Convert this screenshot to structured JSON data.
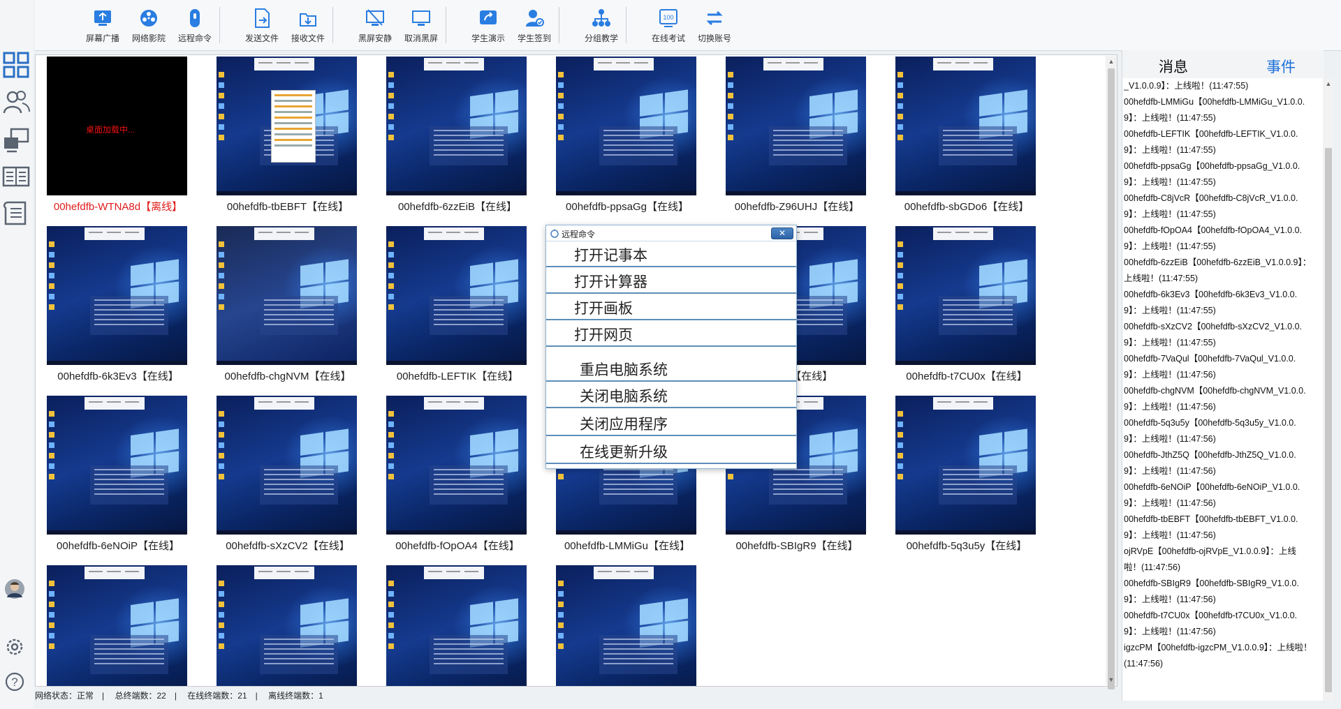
{
  "toolbar": {
    "groups": [
      [
        {
          "label": "屏幕广播",
          "icon": "screen-broadcast-icon"
        },
        {
          "label": "网络影院",
          "icon": "network-cinema-icon"
        },
        {
          "label": "远程命令",
          "icon": "remote-command-icon"
        }
      ],
      [
        {
          "label": "发送文件",
          "icon": "send-file-icon"
        },
        {
          "label": "接收文件",
          "icon": "receive-file-icon"
        }
      ],
      [
        {
          "label": "黑屏安静",
          "icon": "black-screen-icon"
        },
        {
          "label": "取消黑屏",
          "icon": "cancel-black-screen-icon"
        }
      ],
      [
        {
          "label": "学生演示",
          "icon": "student-demo-icon"
        },
        {
          "label": "学生签到",
          "icon": "student-signin-icon"
        }
      ],
      [
        {
          "label": "分组教学",
          "icon": "group-teaching-icon"
        }
      ],
      [
        {
          "label": "在线考试",
          "icon": "online-exam-icon"
        },
        {
          "label": "切换账号",
          "icon": "switch-account-icon"
        }
      ]
    ],
    "accent": "#1a6ed8"
  },
  "left_nav": {
    "items": [
      "grid-view-icon",
      "users-icon",
      "terminal-icon",
      "book-icon",
      "document-icon",
      "avatar",
      "settings-icon",
      "help-icon"
    ]
  },
  "terminals": [
    {
      "name": "00hefdfb-WTNA8d【离线】",
      "status": "offline",
      "screen_text": "桌面加载中..."
    },
    {
      "name": "00hefdfb-tbEBFT【在线】",
      "status": "online"
    },
    {
      "name": "00hefdfb-6zzEiB【在线】",
      "status": "online"
    },
    {
      "name": "00hefdfb-ppsaGg【在线】",
      "status": "online"
    },
    {
      "name": "00hefdfb-Z96UHJ【在线】",
      "status": "online"
    },
    {
      "name": "00hefdfb-sbGDo6【在线】",
      "status": "online"
    },
    {
      "name": "00hefdfb-6k3Ev3【在线】",
      "status": "online"
    },
    {
      "name": "00hefdfb-chgNVM【在线】",
      "status": "online"
    },
    {
      "name": "00hefdfb-LEFTIK【在线】",
      "status": "online"
    },
    {
      "name": "",
      "status": "hidden"
    },
    {
      "name": "mU5N【在线】",
      "status": "online"
    },
    {
      "name": "00hefdfb-t7CU0x【在线】",
      "status": "online"
    },
    {
      "name": "00hefdfb-6eNOiP【在线】",
      "status": "online"
    },
    {
      "name": "00hefdfb-sXzCV2【在线】",
      "status": "online"
    },
    {
      "name": "00hefdfb-fOpOA4【在线】",
      "status": "online"
    },
    {
      "name": "00hefdfb-LMMiGu【在线】",
      "status": "online"
    },
    {
      "name": "00hefdfb-SBIgR9【在线】",
      "status": "online"
    },
    {
      "name": "00hefdfb-5q3u5y【在线】",
      "status": "online"
    },
    {
      "name": "",
      "status": "online"
    },
    {
      "name": "",
      "status": "online"
    },
    {
      "name": "",
      "status": "online"
    },
    {
      "name": "",
      "status": "online"
    }
  ],
  "popup": {
    "title": "远程命令",
    "close": "✕",
    "group1": [
      "打开记事本",
      "打开计算器",
      "打开画板",
      "打开网页"
    ],
    "group2": [
      "重启电脑系统",
      "关闭电脑系统",
      "关闭应用程序",
      "在线更新升级"
    ]
  },
  "right_panel": {
    "tab_messages": "消息",
    "tab_events": "事件",
    "tab_events_color": "#1a6ed8",
    "log": [
      "_V1.0.0.9】：上线啦！(11:47:55)",
      "00hefdfb-LMMiGu【00hefdfb-LMMiGu_V1.0.0.9】：上线啦！(11:47:55)",
      "00hefdfb-LEFTIK【00hefdfb-LEFTIK_V1.0.0.9】：上线啦！(11:47:55)",
      "00hefdfb-ppsaGg【00hefdfb-ppsaGg_V1.0.0.9】：上线啦！(11:47:55)",
      "00hefdfb-C8jVcR【00hefdfb-C8jVcR_V1.0.0.9】：上线啦！(11:47:55)",
      "00hefdfb-fOpOA4【00hefdfb-fOpOA4_V1.0.0.9】：上线啦！(11:47:55)",
      "00hefdfb-6zzEiB【00hefdfb-6zzEiB_V1.0.0.9】：上线啦！(11:47:55)",
      "00hefdfb-6k3Ev3【00hefdfb-6k3Ev3_V1.0.0.9】：上线啦！(11:47:55)",
      "00hefdfb-sXzCV2【00hefdfb-sXzCV2_V1.0.0.9】：上线啦！(11:47:55)",
      "00hefdfb-7VaQul【00hefdfb-7VaQul_V1.0.0.9】：上线啦！(11:47:56)",
      "00hefdfb-chgNVM【00hefdfb-chgNVM_V1.0.0.9】：上线啦！(11:47:56)",
      "00hefdfb-5q3u5y【00hefdfb-5q3u5y_V1.0.0.9】：上线啦！(11:47:56)",
      "00hefdfb-JthZ5Q【00hefdfb-JthZ5Q_V1.0.0.9】：上线啦！(11:47:56)",
      "00hefdfb-6eNOiP【00hefdfb-6eNOiP_V1.0.0.9】：上线啦！(11:47:56)",
      "00hefdfb-tbEBFT【00hefdfb-tbEBFT_V1.0.0.9】：上线啦！(11:47:56)",
      "ojRVpE【00hefdfb-ojRVpE_V1.0.0.9】：上线啦！(11:47:56)",
      "00hefdfb-SBIgR9【00hefdfb-SBIgR9_V1.0.0.9】：上线啦！(11:47:56)",
      "00hefdfb-t7CU0x【00hefdfb-t7CU0x_V1.0.0.9】：上线啦！(11:47:56)",
      "igzcPM【00hefdfb-igzcPM_V1.0.0.9】：上线啦！(11:47:56)"
    ]
  },
  "status_bar": {
    "network": "网络状态：正常",
    "total": "总终端数：22",
    "online": "在线终端数：21",
    "offline": "离线终端数：1"
  }
}
